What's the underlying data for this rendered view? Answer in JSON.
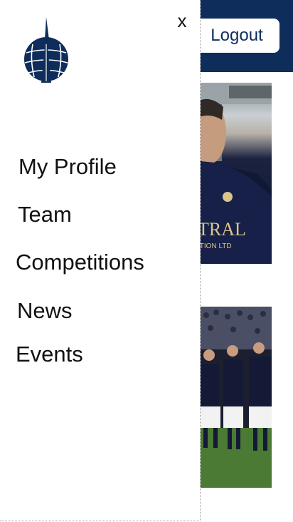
{
  "header": {
    "logout_label": "Logout"
  },
  "drawer": {
    "close_label": "x",
    "menu": [
      {
        "label": "My Profile"
      },
      {
        "label": "Team"
      },
      {
        "label": "Competitions"
      },
      {
        "label": "News"
      },
      {
        "label": "Events"
      }
    ]
  },
  "colors": {
    "brand_navy": "#0e2d5a",
    "drawer_bg": "#ffffff"
  },
  "icons": {
    "crest": "club-crest-icon",
    "close": "close-icon"
  }
}
